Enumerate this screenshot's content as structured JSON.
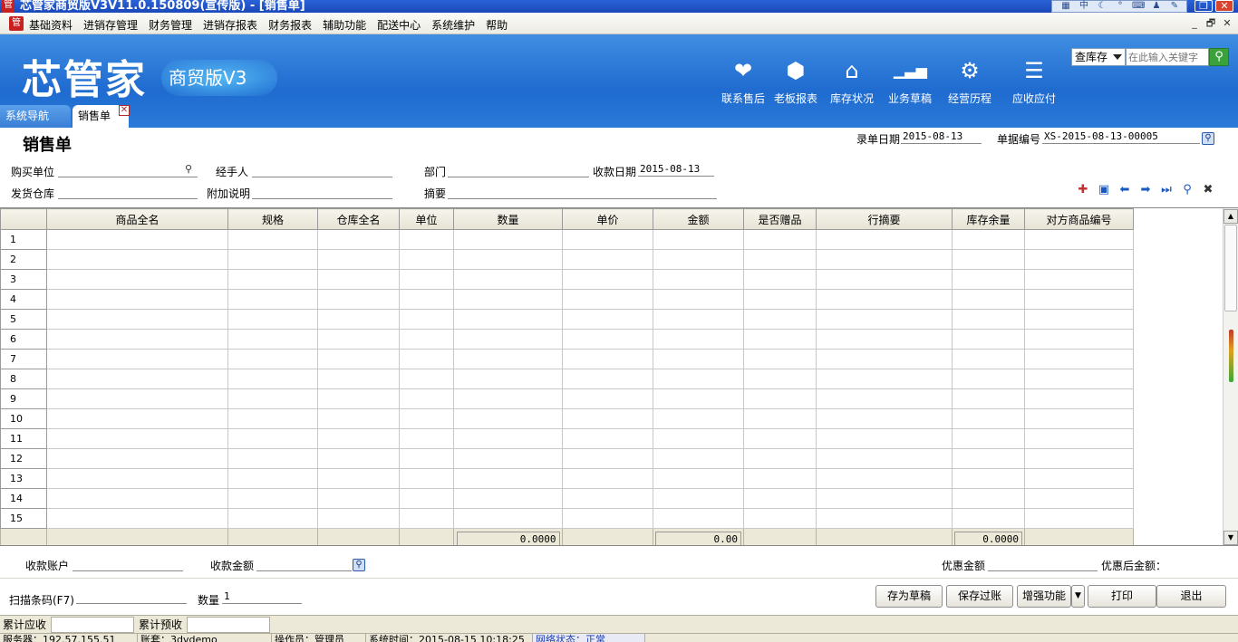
{
  "window": {
    "title": "芯管家商贸版V3V11.0.150809(宣传版) - [销售单]",
    "minimize": "_",
    "restore": "❐",
    "close": "✕"
  },
  "menubar": {
    "items": [
      "基础资料",
      "进销存管理",
      "财务管理",
      "进销存报表",
      "财务报表",
      "辅助功能",
      "配送中心",
      "系统维护",
      "帮助"
    ],
    "mdi_min": "_",
    "mdi_restore": "🗗",
    "mdi_close": "✕"
  },
  "banner": {
    "logo": "芯管家",
    "logo_sub": "商贸版V3",
    "quick": [
      {
        "label": "联系售后",
        "icon": "handshake-icon",
        "glyph": "❤"
      },
      {
        "label": "老板报表",
        "icon": "cube-icon",
        "glyph": "⬢"
      },
      {
        "label": "库存状况",
        "icon": "house-icon",
        "glyph": "⌂"
      },
      {
        "label": "业务草稿",
        "icon": "bar-chart-icon",
        "glyph": "▁▃▅"
      },
      {
        "label": "经营历程",
        "icon": "gear-icon",
        "glyph": "⚙"
      },
      {
        "label": "应收应付",
        "icon": "ledger-icon",
        "glyph": "☰"
      }
    ],
    "search_scope": "查库存",
    "search_placeholder": "在此输入关键字"
  },
  "tabs": {
    "nav": "系统导航",
    "active": "销售单",
    "close": "✕"
  },
  "form": {
    "title": "销售单",
    "entry_date_label": "录单日期",
    "entry_date": "2015-08-13",
    "doc_no_label": "单据编号",
    "doc_no": "XS-2015-08-13-00005",
    "buyer_label": "购买单位",
    "buyer": "",
    "handler_label": "经手人",
    "handler": "",
    "dept_label": "部门",
    "dept": "",
    "receive_date_label": "收款日期",
    "receive_date": "2015-08-13",
    "warehouse_label": "发货仓库",
    "warehouse": "",
    "note_label": "附加说明",
    "note": "",
    "summary_label": "摘要",
    "summary": ""
  },
  "grid": {
    "columns": [
      "商品全名",
      "规格",
      "仓库全名",
      "单位",
      "数量",
      "单价",
      "金额",
      "是否赠品",
      "行摘要",
      "库存余量",
      "对方商品编号"
    ],
    "rows": [
      "1",
      "2",
      "3",
      "4",
      "5",
      "6",
      "7",
      "8",
      "9",
      "10",
      "11",
      "12",
      "13",
      "14",
      "15"
    ],
    "total_qty": "0.0000",
    "total_amount": "0.00",
    "total_stock": "0.0000"
  },
  "footer": {
    "account_label": "收款账户",
    "account": "",
    "amount_label": "收款金额",
    "amount": "",
    "discount_label": "优惠金额",
    "discount": "",
    "after_discount_label": "优惠后金额：",
    "barcode_label": "扫描条码(F7)",
    "barcode": "",
    "qty_label": "数量",
    "qty": "1",
    "btn_draft": "存为草稿",
    "btn_post": "保存过账",
    "btn_enhance": "增强功能",
    "btn_print": "打印",
    "btn_exit": "退出"
  },
  "status": {
    "ar_label": "累计应收",
    "ar_value": "",
    "adv_label": "累计预收",
    "adv_value": "",
    "server": "服务器：192.57.155.51",
    "account": "账套：3dvdemo",
    "operator": "操作员：管理员",
    "sys_time": "系统时间：2015-08-15 10:18:25",
    "network": "网络状态：正常"
  }
}
